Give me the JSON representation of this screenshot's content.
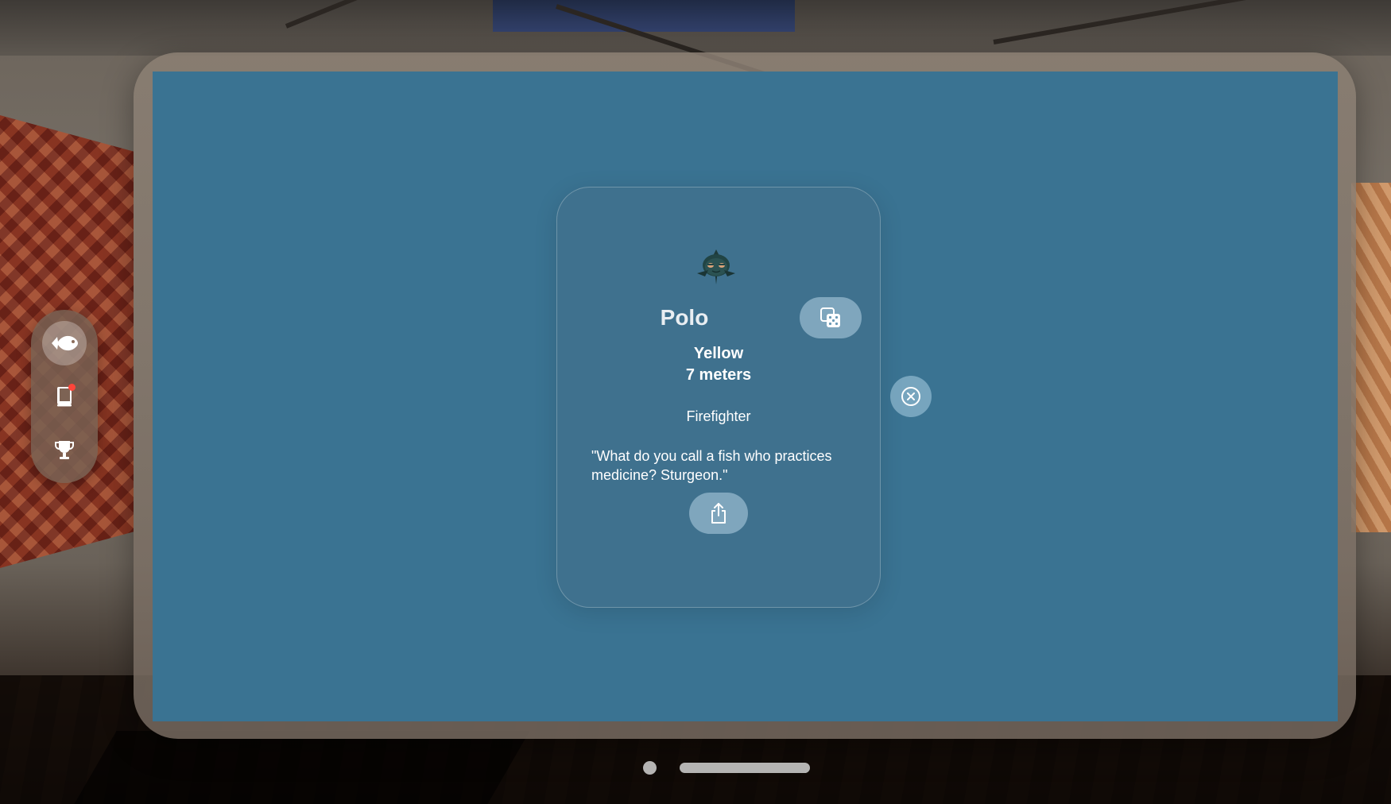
{
  "sidebar": {
    "items": [
      {
        "icon": "fish-icon",
        "selected": true
      },
      {
        "icon": "book-icon",
        "selected": false,
        "has_badge": true
      },
      {
        "icon": "trophy-icon",
        "selected": false
      }
    ],
    "badge_color": "#ff453a"
  },
  "card": {
    "name": "Polo",
    "color": "Yellow",
    "size": "7 meters",
    "job": "Firefighter",
    "quote": "\"What do you call a fish who practices medicine? Sturgeon.\"",
    "randomize_icon": "dice-icon",
    "share_icon": "share-icon"
  },
  "close_icon": "close-circle-icon",
  "colors": {
    "content_background": "#3a7392",
    "button_fill": "#b4d2e4"
  }
}
